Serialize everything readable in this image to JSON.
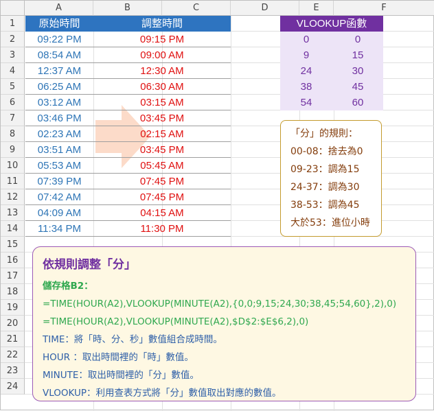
{
  "columns": [
    "A",
    "B",
    "C",
    "D",
    "E",
    "F"
  ],
  "rows": [
    "1",
    "2",
    "3",
    "4",
    "5",
    "6",
    "7",
    "8",
    "9",
    "10",
    "11",
    "12",
    "13",
    "14",
    "15",
    "16",
    "17",
    "18",
    "19",
    "20",
    "21",
    "22",
    "23",
    "24"
  ],
  "table": {
    "header_a": "原始時間",
    "header_b": "調整時間",
    "rows": [
      {
        "orig": "09:22 PM",
        "adj": "09:15 PM"
      },
      {
        "orig": "08:54 AM",
        "adj": "09:00 AM"
      },
      {
        "orig": "12:37 AM",
        "adj": "12:30 AM"
      },
      {
        "orig": "06:25 AM",
        "adj": "06:30 AM"
      },
      {
        "orig": "03:12 AM",
        "adj": "03:15 AM"
      },
      {
        "orig": "03:46 PM",
        "adj": "03:45 PM"
      },
      {
        "orig": "02:23 AM",
        "adj": "02:15 AM"
      },
      {
        "orig": "03:51 AM",
        "adj": "03:45 PM"
      },
      {
        "orig": "05:53 AM",
        "adj": "05:45 AM"
      },
      {
        "orig": "07:39 PM",
        "adj": "07:45 PM"
      },
      {
        "orig": "07:42 AM",
        "adj": "07:45 PM"
      },
      {
        "orig": "04:09 AM",
        "adj": "04:15 AM"
      },
      {
        "orig": "11:34 PM",
        "adj": "11:30 PM"
      }
    ]
  },
  "vlookup": {
    "header": "VLOOKUP函數",
    "rows": [
      {
        "d": "0",
        "e": "0"
      },
      {
        "d": "9",
        "e": "15"
      },
      {
        "d": "24",
        "e": "30"
      },
      {
        "d": "38",
        "e": "45"
      },
      {
        "d": "54",
        "e": "60"
      }
    ]
  },
  "rules": {
    "title": "「分」的規則：",
    "lines": [
      "00-08：捨去為0",
      "09-23：調為15",
      "24-37：調為30",
      "38-53：調為45",
      "大於53：進位小時"
    ]
  },
  "info": {
    "title": "依規則調整「分」",
    "cell_label": "儲存格B2：",
    "formula1": "=TIME(HOUR(A2),VLOOKUP(MINUTE(A2),{0,0;9,15;24,30;38,45;54,60},2),0)",
    "formula2": "=TIME(HOUR(A2),VLOOKUP(MINUTE(A2),$D$2:$E$6,2),0)",
    "desc_time": "TIME：將「時、分、秒」數值組合成時間。",
    "desc_hour": "HOUR ：取出時間裡的「時」數值。",
    "desc_minute": "MINUTE：取出時間裡的「分」數值。",
    "desc_vlookup": "VLOOKUP：利用查表方式將「分」數值取出對應的數值。"
  },
  "colors": {
    "header_blue": "#2e74c0",
    "time_blue": "#2e75b6",
    "time_red": "#e01010",
    "purple": "#7030a0",
    "lavender": "#ede4f7",
    "rule_brown": "#833c0b",
    "info_bg": "#fef8e3",
    "green": "#2fa84f",
    "arrow": "#fbd5c0"
  }
}
